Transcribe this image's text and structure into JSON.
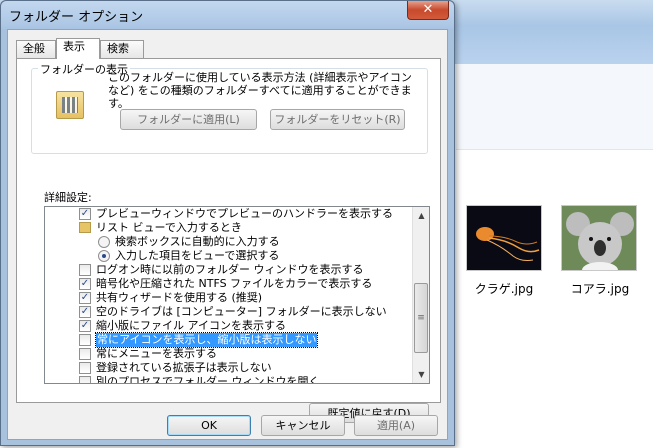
{
  "window": {
    "title": "フォルダー オプション",
    "close_glyph": "✕"
  },
  "tabs": [
    {
      "label": "全般"
    },
    {
      "label": "表示"
    },
    {
      "label": "検索"
    }
  ],
  "folder_view": {
    "title": "フォルダーの表示",
    "description": "このフォルダーに使用している表示方法 (詳細表示やアイコンなど) をこの種類のフォルダーすべてに適用することができます。",
    "apply_button": "フォルダーに適用(L)",
    "reset_button": "フォルダーをリセット(R)"
  },
  "advanced": {
    "label": "詳細設定:",
    "items": [
      {
        "type": "checkbox",
        "checked": true,
        "indent": 0,
        "text": "プレビューウィンドウでプレビューのハンドラーを表示する"
      },
      {
        "type": "folder",
        "indent": 0,
        "text": "リスト ビューで入力するとき"
      },
      {
        "type": "radio",
        "checked": false,
        "indent": 1,
        "text": "検索ボックスに自動的に入力する"
      },
      {
        "type": "radio",
        "checked": true,
        "indent": 1,
        "text": "入力した項目をビューで選択する"
      },
      {
        "type": "checkbox",
        "checked": false,
        "indent": 0,
        "text": "ログオン時に以前のフォルダー ウィンドウを表示する"
      },
      {
        "type": "checkbox",
        "checked": true,
        "indent": 0,
        "text": "暗号化や圧縮された NTFS ファイルをカラーで表示する"
      },
      {
        "type": "checkbox",
        "checked": true,
        "indent": 0,
        "text": "共有ウィザードを使用する (推奨)"
      },
      {
        "type": "checkbox",
        "checked": true,
        "indent": 0,
        "text": "空のドライブは [コンピューター] フォルダーに表示しない"
      },
      {
        "type": "checkbox",
        "checked": true,
        "indent": 0,
        "text": "縮小版にファイル アイコンを表示する"
      },
      {
        "type": "checkbox",
        "checked": false,
        "indent": 0,
        "text": "常にアイコンを表示し、縮小版は表示しない",
        "selected": true
      },
      {
        "type": "checkbox",
        "checked": false,
        "indent": 0,
        "text": "常にメニューを表示する"
      },
      {
        "type": "checkbox",
        "checked": false,
        "indent": 0,
        "text": "登録されている拡張子は表示しない"
      },
      {
        "type": "checkbox",
        "checked": false,
        "indent": 0,
        "text": "別のプロセスでフォルダー ウィンドウを開く"
      }
    ],
    "check_glyph": "✓",
    "defaults_button": "既定値に戻す(D)"
  },
  "buttons": {
    "ok": "OK",
    "cancel": "キャンセル",
    "apply": "適用(A)"
  },
  "explorer": {
    "files": [
      {
        "name": "クラゲ.jpg"
      },
      {
        "name": "コアラ.jpg"
      }
    ]
  }
}
